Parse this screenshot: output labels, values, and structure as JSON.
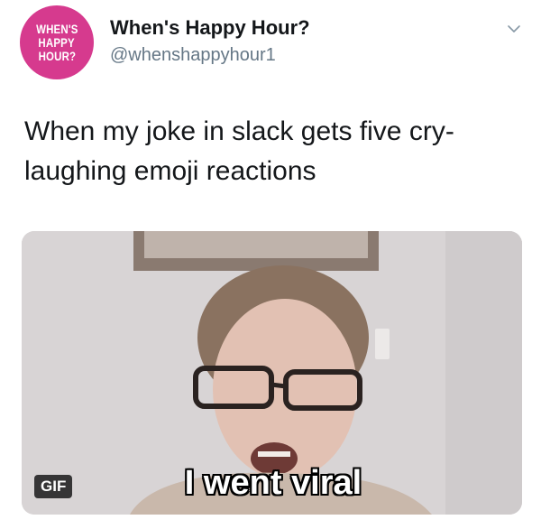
{
  "tweet": {
    "avatar": {
      "lines": [
        "WHEN'S",
        "HAPPY",
        "HOUR?"
      ],
      "color": "#d63a8e"
    },
    "display_name": "When's Happy Hour?",
    "handle": "@whenshappyhour1",
    "menu_icon": "chevron-down-icon",
    "text": "When my joke in slack gets five cry-laughing emoji reactions",
    "media": {
      "badge": "GIF",
      "caption": "I went viral"
    }
  }
}
